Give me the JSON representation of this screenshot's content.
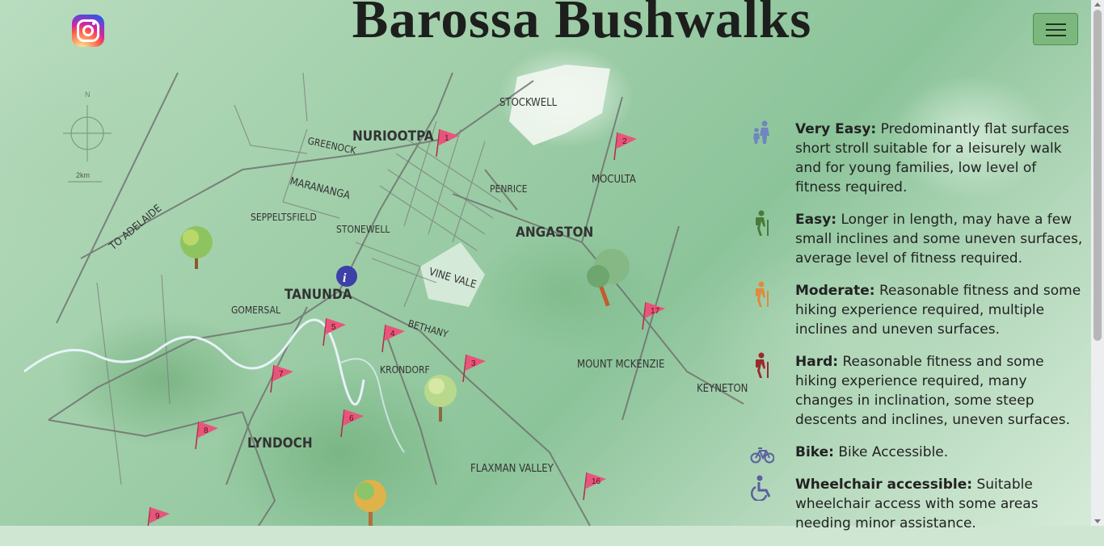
{
  "header": {
    "title": "Barossa Bushwalks"
  },
  "instagram": {
    "icon": "instagram-icon"
  },
  "menu": {
    "icon": "hamburger-menu-icon"
  },
  "map": {
    "compass": {
      "north": "N",
      "scale": "2km"
    },
    "places": {
      "stockwell": "STOCKWELL",
      "nuriootpa": "NURIOOTPA",
      "greenock": "GREENOCK",
      "moculta": "MOCULTA",
      "marananga": "MARANANGA",
      "penrice": "PENRICE",
      "seppeltsfield": "SEPPELTSFIELD",
      "stonewell": "STONEWELL",
      "angaston": "ANGASTON",
      "to_adelaide": "TO ADELAIDE",
      "vine_vale": "VINE VALE",
      "tanunda": "TANUNDA",
      "gomersal": "GOMERSAL",
      "bethany": "BETHANY",
      "krondorf": "KRONDORF",
      "mount_mckenzie": "MOUNT MCKENZIE",
      "keyneton": "KEYNETON",
      "lyndoch": "LYNDOCH",
      "flaxman_valley": "FLAXMAN VALLEY"
    },
    "flags": [
      "1",
      "2",
      "3",
      "4",
      "5",
      "6",
      "7",
      "8",
      "9",
      "16",
      "17"
    ]
  },
  "legend": [
    {
      "icon": "family-walking-icon",
      "color": "#6f86c0",
      "term": "Very Easy:",
      "text": " Predominantly flat surfaces short stroll suitable for a leisurely walk and for young families, low level of fitness required."
    },
    {
      "icon": "hiker-icon",
      "color": "#4a7a3a",
      "term": "Easy:",
      "text": " Longer in length, may have a few small inclines and some uneven surfaces, average level of fitness required."
    },
    {
      "icon": "hiker-icon",
      "color": "#e08a3c",
      "term": "Moderate:",
      "text": " Reasonable fitness and some hiking experience required, multiple inclines and uneven surfaces."
    },
    {
      "icon": "hiker-icon",
      "color": "#9b2a2a",
      "term": "Hard:",
      "text": " Reasonable fitness and some hiking experience required, many changes in inclination, some steep descents and inclines, uneven surfaces."
    },
    {
      "icon": "bicycle-icon",
      "color": "#5a5fa0",
      "term": "Bike:",
      "text": " Bike Accessible."
    },
    {
      "icon": "wheelchair-icon",
      "color": "#5a5fa0",
      "term": "Wheelchair accessible:",
      "text": " Suitable wheelchair access with some areas needing minor assistance."
    }
  ]
}
